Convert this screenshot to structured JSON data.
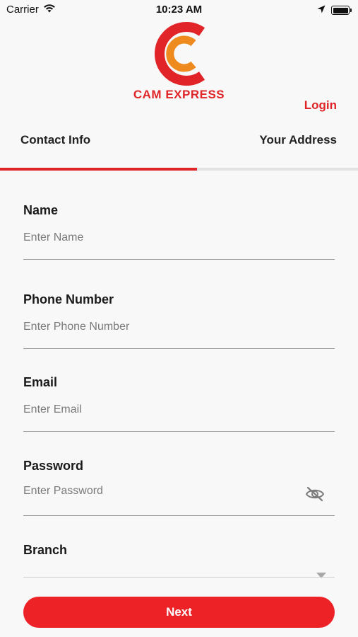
{
  "status_bar": {
    "carrier": "Carrier",
    "time": "10:23 AM",
    "wifi_icon": "wifi-icon",
    "location_icon": "location-arrow-icon",
    "battery_icon": "battery-icon",
    "battery_level": 1.0
  },
  "logo": {
    "text": "CAM EXPRESS",
    "colors": {
      "outer_ring": "#e02428",
      "inner_ring": "#ef8a1e"
    }
  },
  "header": {
    "login_label": "Login"
  },
  "tabs": [
    {
      "label": "Contact Info",
      "active": true
    },
    {
      "label": "Your Address",
      "active": false
    }
  ],
  "progress": {
    "value": 0.55
  },
  "form": {
    "name": {
      "label": "Name",
      "placeholder": "Enter Name",
      "value": ""
    },
    "phone": {
      "label": "Phone Number",
      "placeholder": "Enter Phone Number",
      "value": ""
    },
    "email": {
      "label": "Email",
      "placeholder": "Enter Email",
      "value": ""
    },
    "password": {
      "label": "Password",
      "placeholder": "Enter Password",
      "value": "",
      "toggle_icon": "eye-off-icon"
    },
    "branch": {
      "label": "Branch",
      "value": "",
      "dropdown_icon": "caret-down-icon"
    }
  },
  "actions": {
    "next_label": "Next"
  },
  "colors": {
    "accent": "#ec2227",
    "brand_red": "#e02428",
    "brand_orange": "#ef8a1e",
    "background": "#f8f8f8"
  }
}
